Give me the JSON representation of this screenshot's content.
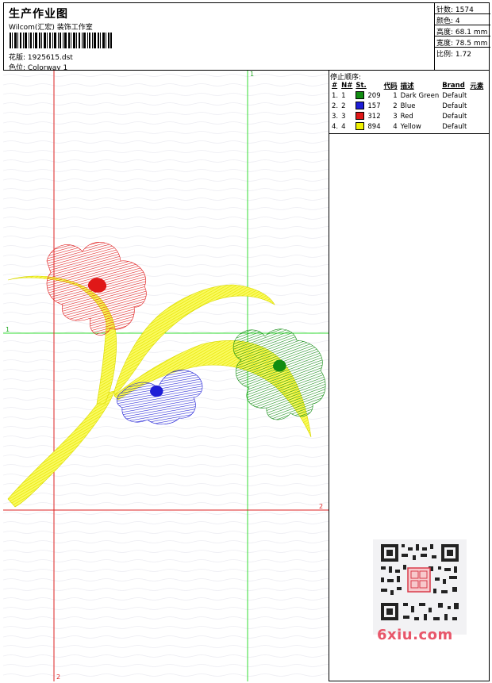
{
  "header": {
    "title": "生产作业图",
    "company": "Wilcom(汇宏) 装饰工作室",
    "design_label": "花版:",
    "design_value": "1925615.dst",
    "colorway_label": "色位:",
    "colorway_value": "Colorway 1"
  },
  "stats": {
    "stitches_label": "针数:",
    "stitches_value": "1574",
    "colors_label": "颜色:",
    "colors_value": "4",
    "height_label": "高度:",
    "height_value": "68.1 mm",
    "width_label": "宽度:",
    "width_value": "78.5 mm",
    "scale_label": "比例:",
    "scale_value": "1.72"
  },
  "stop_sequence": {
    "heading": "停止顺序:",
    "columns": [
      "#",
      "N#",
      "St.",
      "代码",
      "描述",
      "Brand",
      "元素"
    ],
    "rows": [
      {
        "idx": "1.",
        "n": "1",
        "swatch": "#118c11",
        "st": "209",
        "code": "1",
        "desc": "Dark Green",
        "brand": "Default"
      },
      {
        "idx": "2.",
        "n": "2",
        "swatch": "#1d1dd6",
        "st": "157",
        "code": "2",
        "desc": "Blue",
        "brand": "Default"
      },
      {
        "idx": "3.",
        "n": "3",
        "swatch": "#e01818",
        "st": "312",
        "code": "3",
        "desc": "Red",
        "brand": "Default"
      },
      {
        "idx": "4.",
        "n": "4",
        "swatch": "#f0f000",
        "st": "894",
        "code": "4",
        "desc": "Yellow",
        "brand": "Default"
      }
    ]
  },
  "guides": {
    "v1_label": "1",
    "h1_label": "1",
    "h2_label": "2",
    "v2_label": "2"
  },
  "watermark": "6xiu.com",
  "colors": {
    "green_guide": "#33dd33",
    "red_guide": "#dd2222",
    "yellow": "#f2f200",
    "red": "#e01818",
    "green": "#118c11",
    "blue": "#1d1dd6"
  }
}
